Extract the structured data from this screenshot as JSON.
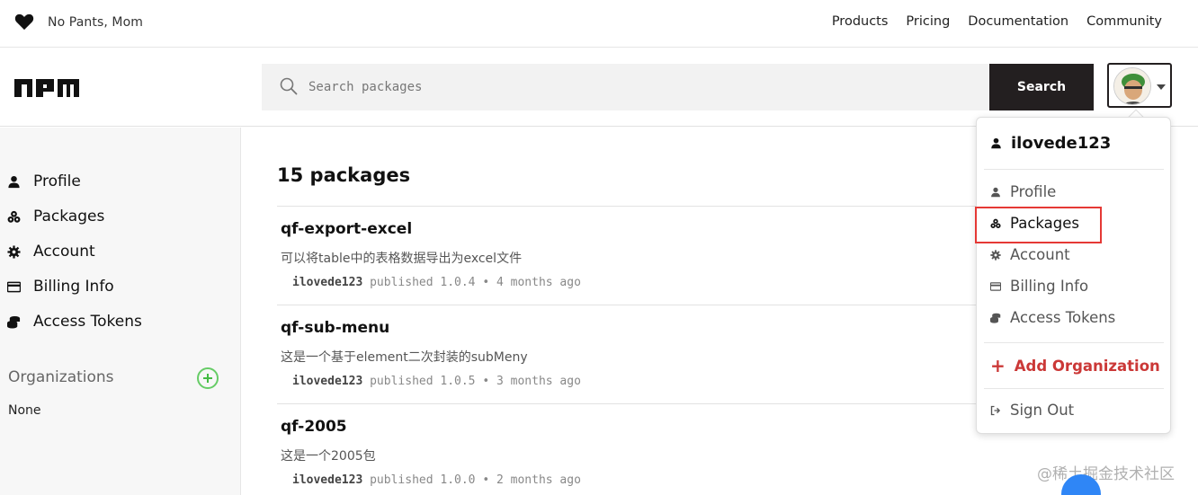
{
  "topbar": {
    "tagline": "No Pants, Mom",
    "nav": [
      "Products",
      "Pricing",
      "Documentation",
      "Community"
    ]
  },
  "header": {
    "logo": "npm",
    "search_placeholder": "Search packages",
    "search_button": "Search"
  },
  "sidebar": {
    "items": [
      {
        "label": "Profile",
        "icon": "user-icon"
      },
      {
        "label": "Packages",
        "icon": "packages-icon"
      },
      {
        "label": "Account",
        "icon": "gear-icon"
      },
      {
        "label": "Billing Info",
        "icon": "credit-card-icon"
      },
      {
        "label": "Access Tokens",
        "icon": "coins-icon"
      }
    ],
    "organizations_title": "Organizations",
    "organizations_empty": "None"
  },
  "main": {
    "count_label": "15 packages",
    "packages": [
      {
        "name": "qf-export-excel",
        "description": "可以将table中的表格数据导出为excel文件",
        "user": "ilovede123",
        "meta": "published 1.0.4 • 4 months ago"
      },
      {
        "name": "qf-sub-menu",
        "description": "这是一个基于element二次封装的subMeny",
        "user": "ilovede123",
        "meta": "published 1.0.5 • 3 months ago"
      },
      {
        "name": "qf-2005",
        "description": "这是一个2005包",
        "user": "ilovede123",
        "meta": "published 1.0.0 • 2 months ago"
      }
    ]
  },
  "dropdown": {
    "username": "ilovede123",
    "items": [
      {
        "label": "Profile",
        "icon": "user-icon"
      },
      {
        "label": "Packages",
        "icon": "packages-icon"
      },
      {
        "label": "Account",
        "icon": "gear-icon"
      },
      {
        "label": "Billing Info",
        "icon": "credit-card-icon"
      },
      {
        "label": "Access Tokens",
        "icon": "coins-icon"
      }
    ],
    "add_org": "Add Organization",
    "sign_out": "Sign Out"
  },
  "watermark": "@稀土掘金技术社区",
  "colors": {
    "brand_red": "#cb3837",
    "highlight": "#e53935",
    "search_button": "#231f20"
  }
}
